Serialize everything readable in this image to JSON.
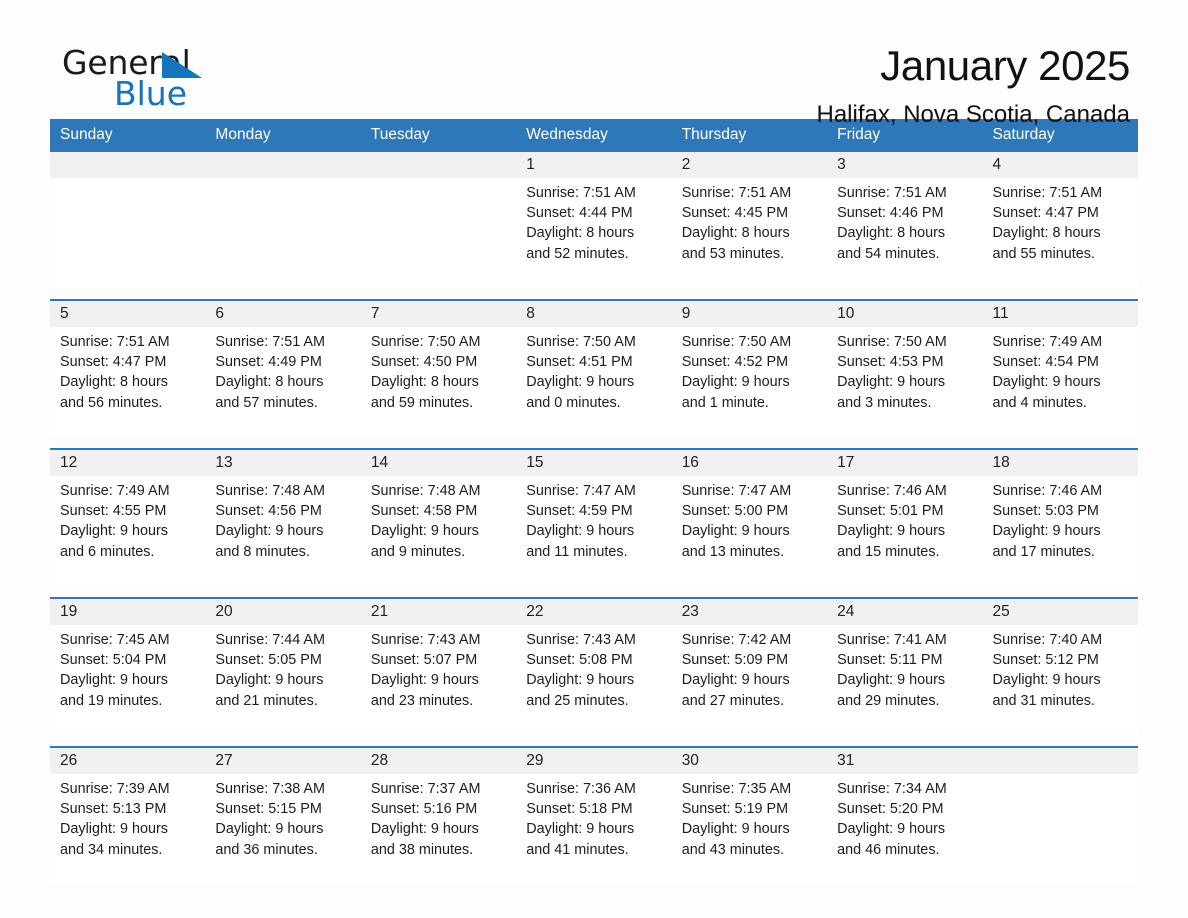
{
  "brand": {
    "name_part1": "General",
    "name_part2": "Blue",
    "accent_color": "#1574ba"
  },
  "header": {
    "title": "January 2025",
    "subtitle": "Halifax, Nova Scotia, Canada"
  },
  "theme": {
    "header_blue": "#2e77b8",
    "daynum_band": "#f1f1f1",
    "page_background": "#fdfdfd"
  },
  "weekday_headers": [
    "Sunday",
    "Monday",
    "Tuesday",
    "Wednesday",
    "Thursday",
    "Friday",
    "Saturday"
  ],
  "weeks": [
    [
      {
        "day": "",
        "lines": []
      },
      {
        "day": "",
        "lines": []
      },
      {
        "day": "",
        "lines": []
      },
      {
        "day": "1",
        "lines": [
          "Sunrise: 7:51 AM",
          "Sunset: 4:44 PM",
          "Daylight: 8 hours",
          "and 52 minutes."
        ]
      },
      {
        "day": "2",
        "lines": [
          "Sunrise: 7:51 AM",
          "Sunset: 4:45 PM",
          "Daylight: 8 hours",
          "and 53 minutes."
        ]
      },
      {
        "day": "3",
        "lines": [
          "Sunrise: 7:51 AM",
          "Sunset: 4:46 PM",
          "Daylight: 8 hours",
          "and 54 minutes."
        ]
      },
      {
        "day": "4",
        "lines": [
          "Sunrise: 7:51 AM",
          "Sunset: 4:47 PM",
          "Daylight: 8 hours",
          "and 55 minutes."
        ]
      }
    ],
    [
      {
        "day": "5",
        "lines": [
          "Sunrise: 7:51 AM",
          "Sunset: 4:47 PM",
          "Daylight: 8 hours",
          "and 56 minutes."
        ]
      },
      {
        "day": "6",
        "lines": [
          "Sunrise: 7:51 AM",
          "Sunset: 4:49 PM",
          "Daylight: 8 hours",
          "and 57 minutes."
        ]
      },
      {
        "day": "7",
        "lines": [
          "Sunrise: 7:50 AM",
          "Sunset: 4:50 PM",
          "Daylight: 8 hours",
          "and 59 minutes."
        ]
      },
      {
        "day": "8",
        "lines": [
          "Sunrise: 7:50 AM",
          "Sunset: 4:51 PM",
          "Daylight: 9 hours",
          "and 0 minutes."
        ]
      },
      {
        "day": "9",
        "lines": [
          "Sunrise: 7:50 AM",
          "Sunset: 4:52 PM",
          "Daylight: 9 hours",
          "and 1 minute."
        ]
      },
      {
        "day": "10",
        "lines": [
          "Sunrise: 7:50 AM",
          "Sunset: 4:53 PM",
          "Daylight: 9 hours",
          "and 3 minutes."
        ]
      },
      {
        "day": "11",
        "lines": [
          "Sunrise: 7:49 AM",
          "Sunset: 4:54 PM",
          "Daylight: 9 hours",
          "and 4 minutes."
        ]
      }
    ],
    [
      {
        "day": "12",
        "lines": [
          "Sunrise: 7:49 AM",
          "Sunset: 4:55 PM",
          "Daylight: 9 hours",
          "and 6 minutes."
        ]
      },
      {
        "day": "13",
        "lines": [
          "Sunrise: 7:48 AM",
          "Sunset: 4:56 PM",
          "Daylight: 9 hours",
          "and 8 minutes."
        ]
      },
      {
        "day": "14",
        "lines": [
          "Sunrise: 7:48 AM",
          "Sunset: 4:58 PM",
          "Daylight: 9 hours",
          "and 9 minutes."
        ]
      },
      {
        "day": "15",
        "lines": [
          "Sunrise: 7:47 AM",
          "Sunset: 4:59 PM",
          "Daylight: 9 hours",
          "and 11 minutes."
        ]
      },
      {
        "day": "16",
        "lines": [
          "Sunrise: 7:47 AM",
          "Sunset: 5:00 PM",
          "Daylight: 9 hours",
          "and 13 minutes."
        ]
      },
      {
        "day": "17",
        "lines": [
          "Sunrise: 7:46 AM",
          "Sunset: 5:01 PM",
          "Daylight: 9 hours",
          "and 15 minutes."
        ]
      },
      {
        "day": "18",
        "lines": [
          "Sunrise: 7:46 AM",
          "Sunset: 5:03 PM",
          "Daylight: 9 hours",
          "and 17 minutes."
        ]
      }
    ],
    [
      {
        "day": "19",
        "lines": [
          "Sunrise: 7:45 AM",
          "Sunset: 5:04 PM",
          "Daylight: 9 hours",
          "and 19 minutes."
        ]
      },
      {
        "day": "20",
        "lines": [
          "Sunrise: 7:44 AM",
          "Sunset: 5:05 PM",
          "Daylight: 9 hours",
          "and 21 minutes."
        ]
      },
      {
        "day": "21",
        "lines": [
          "Sunrise: 7:43 AM",
          "Sunset: 5:07 PM",
          "Daylight: 9 hours",
          "and 23 minutes."
        ]
      },
      {
        "day": "22",
        "lines": [
          "Sunrise: 7:43 AM",
          "Sunset: 5:08 PM",
          "Daylight: 9 hours",
          "and 25 minutes."
        ]
      },
      {
        "day": "23",
        "lines": [
          "Sunrise: 7:42 AM",
          "Sunset: 5:09 PM",
          "Daylight: 9 hours",
          "and 27 minutes."
        ]
      },
      {
        "day": "24",
        "lines": [
          "Sunrise: 7:41 AM",
          "Sunset: 5:11 PM",
          "Daylight: 9 hours",
          "and 29 minutes."
        ]
      },
      {
        "day": "25",
        "lines": [
          "Sunrise: 7:40 AM",
          "Sunset: 5:12 PM",
          "Daylight: 9 hours",
          "and 31 minutes."
        ]
      }
    ],
    [
      {
        "day": "26",
        "lines": [
          "Sunrise: 7:39 AM",
          "Sunset: 5:13 PM",
          "Daylight: 9 hours",
          "and 34 minutes."
        ]
      },
      {
        "day": "27",
        "lines": [
          "Sunrise: 7:38 AM",
          "Sunset: 5:15 PM",
          "Daylight: 9 hours",
          "and 36 minutes."
        ]
      },
      {
        "day": "28",
        "lines": [
          "Sunrise: 7:37 AM",
          "Sunset: 5:16 PM",
          "Daylight: 9 hours",
          "and 38 minutes."
        ]
      },
      {
        "day": "29",
        "lines": [
          "Sunrise: 7:36 AM",
          "Sunset: 5:18 PM",
          "Daylight: 9 hours",
          "and 41 minutes."
        ]
      },
      {
        "day": "30",
        "lines": [
          "Sunrise: 7:35 AM",
          "Sunset: 5:19 PM",
          "Daylight: 9 hours",
          "and 43 minutes."
        ]
      },
      {
        "day": "31",
        "lines": [
          "Sunrise: 7:34 AM",
          "Sunset: 5:20 PM",
          "Daylight: 9 hours",
          "and 46 minutes."
        ]
      },
      {
        "day": "",
        "lines": []
      }
    ]
  ]
}
